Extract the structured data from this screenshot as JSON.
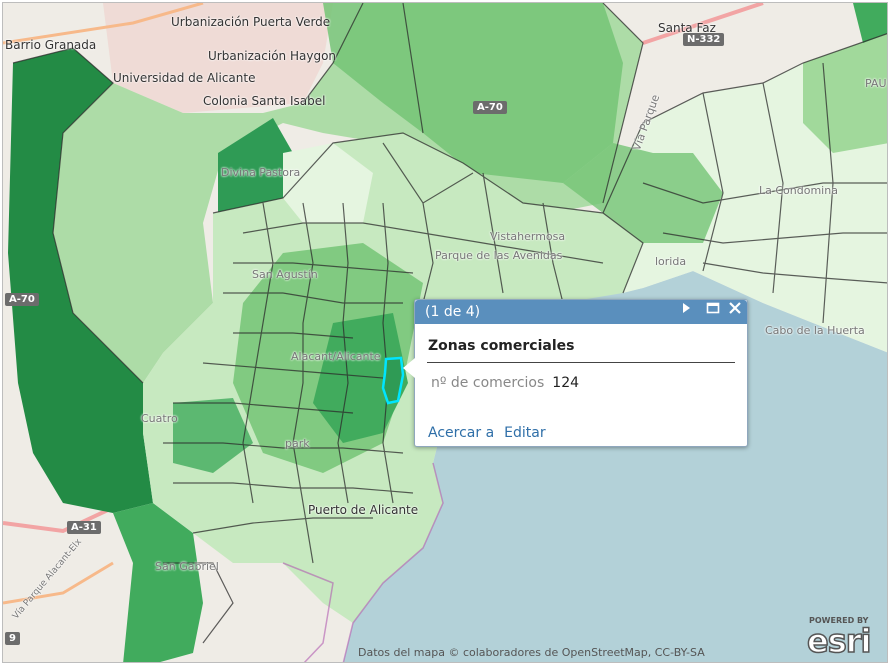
{
  "map_labels": {
    "barrio_granada": "Barrio Granada",
    "urb_puerta_verde": "Urbanización Puerta Verde",
    "urb_haygon": "Urbanización Haygon",
    "universidad": "Universidad de Alicante",
    "colonia": "Colonia Santa Isabel",
    "santa_faz": "Santa Faz",
    "divina_pastora": "Divina Pastora",
    "vistahermosa": "Vistahermosa",
    "parque_avenidas": "Parque de las Avenidas",
    "la_condomina": "La Condomina",
    "san_agustin": "San Agustín",
    "alacant": "Alacant/Alicante",
    "cabo_huerta": "Cabo de la Huerta",
    "puerto": "Puerto de Alicante",
    "san_gabriel": "San Gabriel",
    "via_parque": "Vía Parque",
    "via_parque_elx": "Vía Parque Alacant-Elx",
    "pau": "PAU",
    "cuatro": "Cuatro",
    "park": "park",
    "florida": "lorida"
  },
  "road_shields": {
    "a70_top": "A-70",
    "a70_left": "A-70",
    "a31": "A-31",
    "n332": "N-332",
    "nine": "9"
  },
  "popup": {
    "counter": "(1 de 4)",
    "layer_title": "Zonas comerciales",
    "field_label": "nº de comercios",
    "field_value": "124",
    "action_zoom": "Acercar a",
    "action_edit": "Editar"
  },
  "attribution": "Datos del mapa © colaboradores de OpenStreetMap, CC-BY-SA",
  "logo": {
    "small": "POWERED BY",
    "big": "esri"
  },
  "colors": {
    "sea": "#b3d1d8",
    "land": "#efece6",
    "choropleth_light": "#e3f2dc",
    "choropleth_mid": "#8ccb8c",
    "choropleth_dark": "#238b45",
    "selection": "#00e5ff",
    "popup_header": "#5a8fbd",
    "link": "#2f6fa8"
  }
}
